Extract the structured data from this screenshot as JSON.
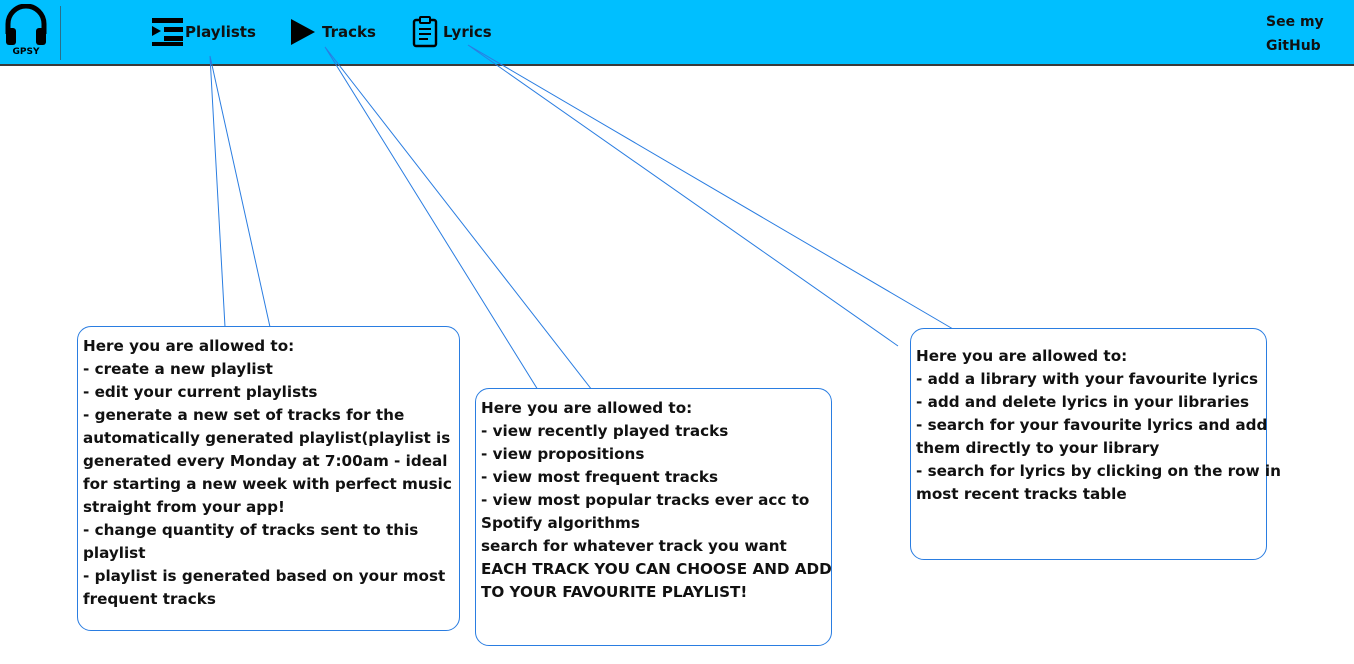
{
  "navbar": {
    "logo_text": "GPSY",
    "items": [
      {
        "label": "Playlists",
        "icon": "playlist-icon"
      },
      {
        "label": "Tracks",
        "icon": "play-icon"
      },
      {
        "label": "Lyrics",
        "icon": "clipboard-icon"
      }
    ],
    "github_line1": "See my",
    "github_line2": "GitHub"
  },
  "callouts": {
    "playlists": [
      "Here you are allowed to:",
      "- create a new playlist",
      "- edit your current playlists",
      "- generate a new set of tracks for the",
      "automatically generated playlist(playlist is",
      "generated every Monday at 7:00am - ideal",
      "for starting a new week with perfect music",
      "straight from your app!",
      "- change quantity of tracks sent to this",
      "playlist",
      "- playlist is generated based on your most",
      "frequent tracks"
    ],
    "tracks": [
      "Here you are allowed to:",
      "- view recently played tracks",
      "- view propositions",
      "- view most frequent tracks",
      "- view most popular tracks ever acc to",
      "Spotify algorithms",
      "search for whatever track you want",
      "EACH TRACK YOU CAN CHOOSE AND ADD",
      "TO YOUR FAVOURITE PLAYLIST!"
    ],
    "lyrics": [
      "Here you are allowed to:",
      "- add a library with your favourite lyrics",
      "- add and delete lyrics in your libraries",
      "- search for your favourite lyrics and add",
      "them directly to your library",
      "- search for lyrics by clicking on the row in",
      "most recent tracks table"
    ]
  },
  "colors": {
    "navbar_bg": "#00bfff",
    "callout_border": "#2a7de1"
  }
}
